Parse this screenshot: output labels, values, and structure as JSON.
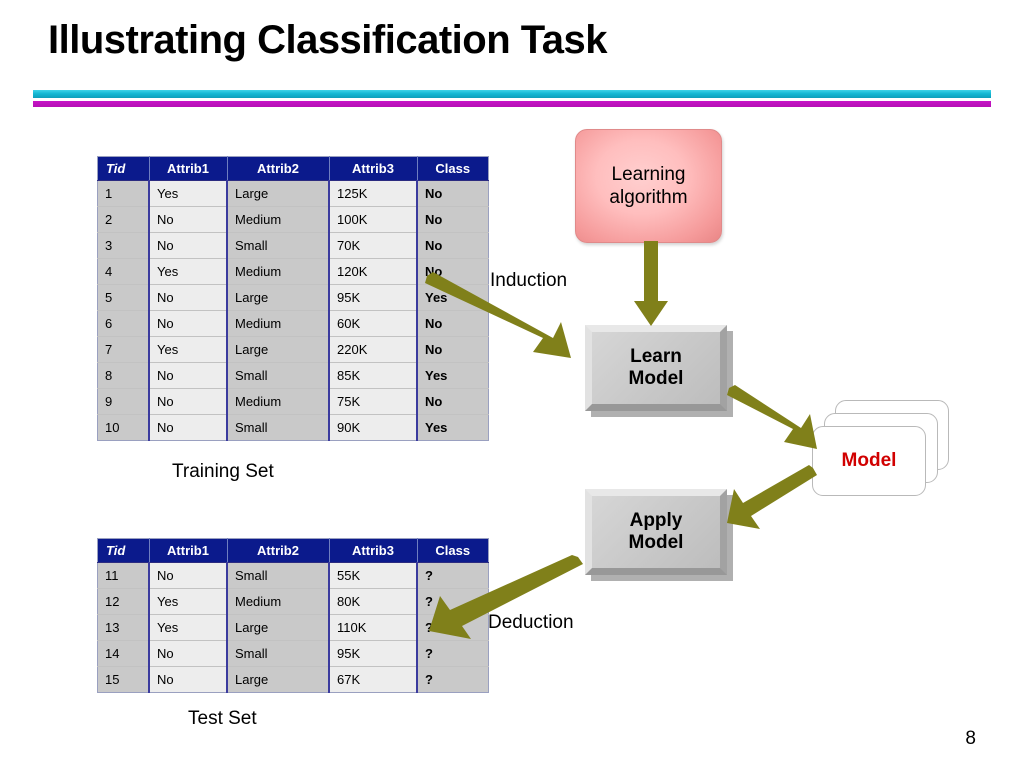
{
  "slide": {
    "title": "Illustrating Classification Task",
    "page_number": "8",
    "accent_teal": "#14b8d4",
    "accent_magenta": "#b510b5",
    "arrow_color": "#80801a",
    "class_text_color": "#d80000",
    "header_bg": "#0b1a8c",
    "learning_box_color": "#ffbebe"
  },
  "training_table": {
    "caption": "Training Set",
    "columns": [
      "Tid",
      "Attrib1",
      "Attrib2",
      "Attrib3",
      "Class"
    ],
    "rows": [
      [
        "1",
        "Yes",
        "Large",
        "125K",
        "No"
      ],
      [
        "2",
        "No",
        "Medium",
        "100K",
        "No"
      ],
      [
        "3",
        "No",
        "Small",
        "70K",
        "No"
      ],
      [
        "4",
        "Yes",
        "Medium",
        "120K",
        "No"
      ],
      [
        "5",
        "No",
        "Large",
        "95K",
        "Yes"
      ],
      [
        "6",
        "No",
        "Medium",
        "60K",
        "No"
      ],
      [
        "7",
        "Yes",
        "Large",
        "220K",
        "No"
      ],
      [
        "8",
        "No",
        "Small",
        "85K",
        "Yes"
      ],
      [
        "9",
        "No",
        "Medium",
        "75K",
        "No"
      ],
      [
        "10",
        "No",
        "Small",
        "90K",
        "Yes"
      ]
    ]
  },
  "test_table": {
    "caption": "Test Set",
    "columns": [
      "Tid",
      "Attrib1",
      "Attrib2",
      "Attrib3",
      "Class"
    ],
    "rows": [
      [
        "11",
        "No",
        "Small",
        "55K",
        "?"
      ],
      [
        "12",
        "Yes",
        "Medium",
        "80K",
        "?"
      ],
      [
        "13",
        "Yes",
        "Large",
        "110K",
        "?"
      ],
      [
        "14",
        "No",
        "Small",
        "95K",
        "?"
      ],
      [
        "15",
        "No",
        "Large",
        "67K",
        "?"
      ]
    ]
  },
  "diagram": {
    "learning_algorithm": "Learning\nalgorithm",
    "learn_model": "Learn\nModel",
    "apply_model": "Apply\nModel",
    "model_card": "Model",
    "induction_label": "Induction",
    "deduction_label": "Deduction"
  }
}
